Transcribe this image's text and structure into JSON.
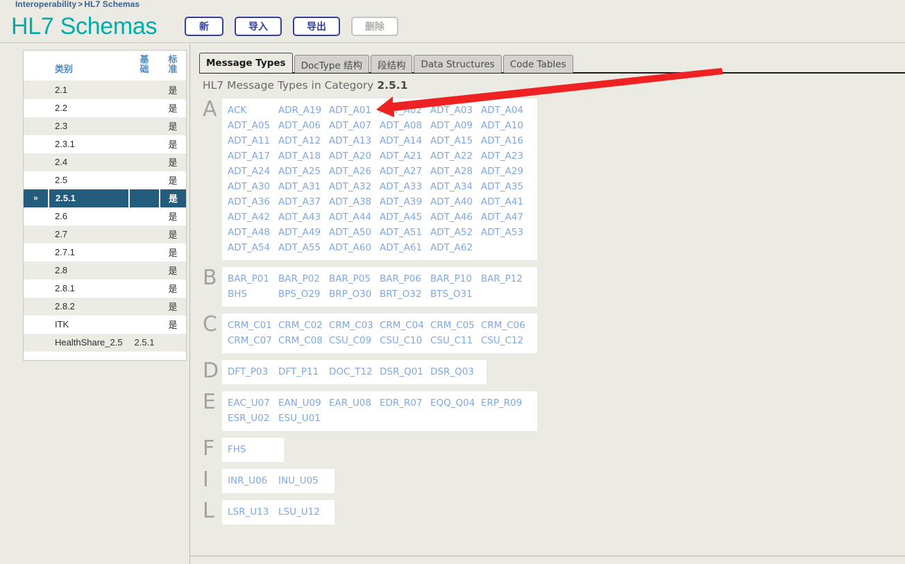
{
  "breadcrumb": {
    "root": "Interoperability",
    "separator": ">",
    "current": "HL7 Schemas"
  },
  "header": {
    "title": "HL7 Schemas",
    "title_color": "#00ada8",
    "buttons": [
      {
        "label": "新",
        "name": "new-button",
        "disabled": false
      },
      {
        "label": "导入",
        "name": "import-button",
        "disabled": false
      },
      {
        "label": "导出",
        "name": "export-button",
        "disabled": false
      },
      {
        "label": "删除",
        "name": "delete-button",
        "disabled": true
      }
    ]
  },
  "sidebar": {
    "columns": [
      "",
      "类别",
      "基础",
      "标准"
    ],
    "rows": [
      {
        "marker": "",
        "category": "2.1",
        "base": "",
        "standard": "是",
        "selected": false
      },
      {
        "marker": "",
        "category": "2.2",
        "base": "",
        "standard": "是",
        "selected": false
      },
      {
        "marker": "",
        "category": "2.3",
        "base": "",
        "standard": "是",
        "selected": false
      },
      {
        "marker": "",
        "category": "2.3.1",
        "base": "",
        "standard": "是",
        "selected": false
      },
      {
        "marker": "",
        "category": "2.4",
        "base": "",
        "standard": "是",
        "selected": false
      },
      {
        "marker": "",
        "category": "2.5",
        "base": "",
        "standard": "是",
        "selected": false
      },
      {
        "marker": "»",
        "category": "2.5.1",
        "base": "",
        "standard": "是",
        "selected": true
      },
      {
        "marker": "",
        "category": "2.6",
        "base": "",
        "standard": "是",
        "selected": false
      },
      {
        "marker": "",
        "category": "2.7",
        "base": "",
        "standard": "是",
        "selected": false
      },
      {
        "marker": "",
        "category": "2.7.1",
        "base": "",
        "standard": "是",
        "selected": false
      },
      {
        "marker": "",
        "category": "2.8",
        "base": "",
        "standard": "是",
        "selected": false
      },
      {
        "marker": "",
        "category": "2.8.1",
        "base": "",
        "standard": "是",
        "selected": false
      },
      {
        "marker": "",
        "category": "2.8.2",
        "base": "",
        "standard": "是",
        "selected": false
      },
      {
        "marker": "",
        "category": "ITK",
        "base": "",
        "standard": "是",
        "selected": false
      },
      {
        "marker": "",
        "category": "HealthShare_2.5",
        "base": "2.5.1",
        "standard": "",
        "selected": false
      }
    ]
  },
  "tabs": [
    {
      "label": "Message Types",
      "active": true
    },
    {
      "label": "DocType 结构",
      "active": false
    },
    {
      "label": "段结构",
      "active": false
    },
    {
      "label": "Data Structures",
      "active": false
    },
    {
      "label": "Code Tables",
      "active": false
    }
  ],
  "content": {
    "heading_prefix": "HL7 Message Types in Category ",
    "heading_category": "2.5.1",
    "link_color": "#7fa8e0",
    "groups": [
      {
        "letter": "A",
        "columns": 6,
        "items": [
          "ACK",
          "ADR_A19",
          "ADT_A01",
          "ADT_A02",
          "ADT_A03",
          "ADT_A04",
          "ADT_A05",
          "ADT_A06",
          "ADT_A07",
          "ADT_A08",
          "ADT_A09",
          "ADT_A10",
          "ADT_A11",
          "ADT_A12",
          "ADT_A13",
          "ADT_A14",
          "ADT_A15",
          "ADT_A16",
          "ADT_A17",
          "ADT_A18",
          "ADT_A20",
          "ADT_A21",
          "ADT_A22",
          "ADT_A23",
          "ADT_A24",
          "ADT_A25",
          "ADT_A26",
          "ADT_A27",
          "ADT_A28",
          "ADT_A29",
          "ADT_A30",
          "ADT_A31",
          "ADT_A32",
          "ADT_A33",
          "ADT_A34",
          "ADT_A35",
          "ADT_A36",
          "ADT_A37",
          "ADT_A38",
          "ADT_A39",
          "ADT_A40",
          "ADT_A41",
          "ADT_A42",
          "ADT_A43",
          "ADT_A44",
          "ADT_A45",
          "ADT_A46",
          "ADT_A47",
          "ADT_A48",
          "ADT_A49",
          "ADT_A50",
          "ADT_A51",
          "ADT_A52",
          "ADT_A53",
          "ADT_A54",
          "ADT_A55",
          "ADT_A60",
          "ADT_A61",
          "ADT_A62"
        ]
      },
      {
        "letter": "B",
        "columns": 6,
        "items": [
          "BAR_P01",
          "BAR_P02",
          "BAR_P05",
          "BAR_P06",
          "BAR_P10",
          "BAR_P12",
          "BHS",
          "BPS_O29",
          "BRP_O30",
          "BRT_O32",
          "BTS_O31"
        ]
      },
      {
        "letter": "C",
        "columns": 6,
        "items": [
          "CRM_C01",
          "CRM_C02",
          "CRM_C03",
          "CRM_C04",
          "CRM_C05",
          "CRM_C06",
          "CRM_C07",
          "CRM_C08",
          "CSU_C09",
          "CSU_C10",
          "CSU_C11",
          "CSU_C12"
        ]
      },
      {
        "letter": "D",
        "columns": 6,
        "items": [
          "DFT_P03",
          "DFT_P11",
          "DOC_T12",
          "DSR_Q01",
          "DSR_Q03"
        ]
      },
      {
        "letter": "E",
        "columns": 6,
        "items": [
          "EAC_U07",
          "EAN_U09",
          "EAR_U08",
          "EDR_R07",
          "EQQ_Q04",
          "ERP_R09",
          "ESR_U02",
          "ESU_U01"
        ]
      },
      {
        "letter": "F",
        "columns": 6,
        "items": [
          "FHS"
        ]
      },
      {
        "letter": "I",
        "columns": 6,
        "items": [
          "INR_U06",
          "INU_U05"
        ]
      },
      {
        "letter": "L",
        "columns": 6,
        "items": [
          "LSR_U13",
          "LSU_U12"
        ]
      }
    ]
  },
  "annotation": {
    "color": "#ee2222",
    "type": "arrow",
    "points_at": "ADT_A01"
  }
}
